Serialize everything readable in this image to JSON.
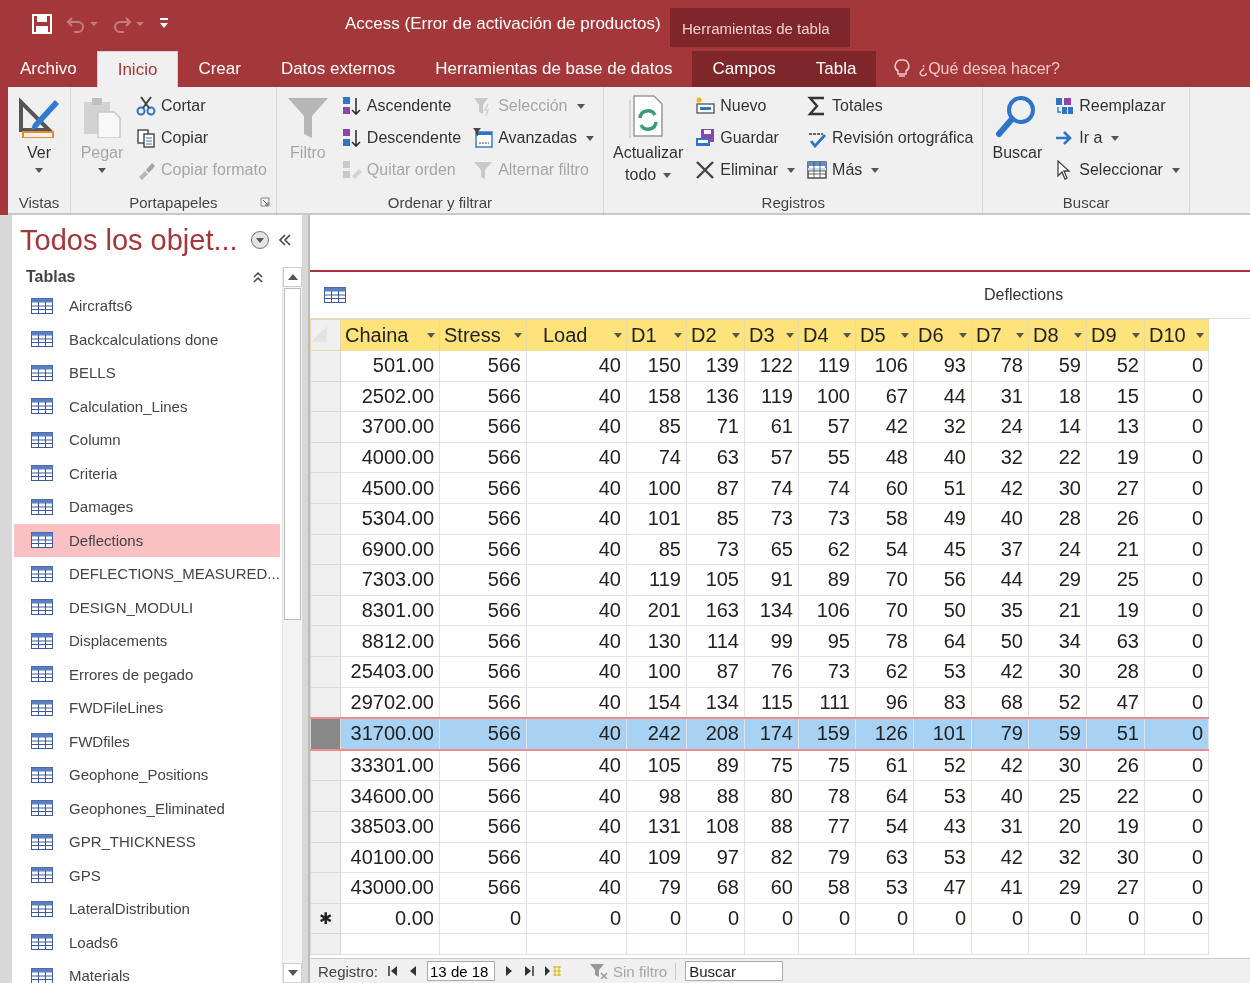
{
  "window": {
    "title": "Access (Error de activación de productos)",
    "contextual_header": "Herramientas de tabla"
  },
  "quick_access": [
    {
      "disabled": false
    },
    {
      "disabled": true
    },
    {
      "disabled": true
    }
  ],
  "tabs": [
    {
      "label": "Archivo",
      "selected": false,
      "contextual": false
    },
    {
      "label": "Inicio",
      "selected": true,
      "contextual": false
    },
    {
      "label": "Crear",
      "selected": false,
      "contextual": false
    },
    {
      "label": "Datos externos",
      "selected": false,
      "contextual": false
    },
    {
      "label": "Herramientas de base de datos",
      "selected": false,
      "contextual": false
    },
    {
      "label": "Campos",
      "selected": false,
      "contextual": true
    },
    {
      "label": "Tabla",
      "selected": false,
      "contextual": true
    }
  ],
  "tell_me": {
    "placeholder": "¿Qué desea hacer?"
  },
  "ribbon": {
    "groups": [
      {
        "label": "Vistas",
        "launcher": false,
        "items": [
          {
            "kind": "large",
            "lines": [
              "Ver"
            ],
            "disabled": false,
            "dropdown": true
          }
        ]
      },
      {
        "label": "Portapapeles",
        "launcher": true,
        "items": [
          {
            "kind": "large",
            "lines": [
              "Pegar"
            ],
            "disabled": true,
            "dropdown": true
          },
          {
            "kind": "stack",
            "buttons": [
              {
                "label": "Cortar",
                "disabled": false,
                "dropdown": false
              },
              {
                "label": "Copiar",
                "disabled": false,
                "dropdown": false
              },
              {
                "label": "Copiar formato",
                "disabled": true,
                "dropdown": false
              }
            ]
          }
        ]
      },
      {
        "label": "Ordenar y filtrar",
        "launcher": false,
        "items": [
          {
            "kind": "large",
            "lines": [
              "Filtro"
            ],
            "disabled": true,
            "dropdown": false
          },
          {
            "kind": "stack",
            "buttons": [
              {
                "label": "Ascendente",
                "disabled": false,
                "dropdown": false
              },
              {
                "label": "Descendente",
                "disabled": false,
                "dropdown": false
              },
              {
                "label": "Quitar orden",
                "disabled": true,
                "dropdown": false
              }
            ]
          },
          {
            "kind": "stack",
            "buttons": [
              {
                "label": "Selección",
                "disabled": true,
                "dropdown": true
              },
              {
                "label": "Avanzadas",
                "disabled": false,
                "dropdown": true
              },
              {
                "label": "Alternar filtro",
                "disabled": true,
                "dropdown": false
              }
            ]
          }
        ]
      },
      {
        "label": "Registros",
        "launcher": false,
        "items": [
          {
            "kind": "large",
            "lines": [
              "Actualizar",
              "todo"
            ],
            "disabled": false,
            "dropdown": true
          },
          {
            "kind": "stack",
            "buttons": [
              {
                "label": "Nuevo",
                "disabled": false,
                "dropdown": false
              },
              {
                "label": "Guardar",
                "disabled": false,
                "dropdown": false
              },
              {
                "label": "Eliminar",
                "disabled": false,
                "dropdown": true
              }
            ]
          },
          {
            "kind": "stack",
            "buttons": [
              {
                "label": "Totales",
                "disabled": false,
                "dropdown": false
              },
              {
                "label": "Revisión ortográfica",
                "disabled": false,
                "dropdown": false
              },
              {
                "label": "Más",
                "disabled": false,
                "dropdown": true
              }
            ]
          }
        ]
      },
      {
        "label": "Buscar",
        "launcher": false,
        "items": [
          {
            "kind": "large",
            "lines": [
              "Buscar"
            ],
            "disabled": false,
            "dropdown": false
          },
          {
            "kind": "stack",
            "buttons": [
              {
                "label": "Reemplazar",
                "disabled": false,
                "dropdown": false
              },
              {
                "label": "Ir a",
                "disabled": false,
                "dropdown": true
              },
              {
                "label": "Seleccionar",
                "disabled": false,
                "dropdown": true
              }
            ]
          }
        ]
      }
    ]
  },
  "navigation": {
    "title": "Todos los objet...",
    "section": "Tablas",
    "items": [
      {
        "label": "Aircrafts6",
        "selected": false
      },
      {
        "label": "Backcalculations done",
        "selected": false
      },
      {
        "label": "BELLS",
        "selected": false
      },
      {
        "label": "Calculation_Lines",
        "selected": false
      },
      {
        "label": "Column",
        "selected": false
      },
      {
        "label": "Criteria",
        "selected": false
      },
      {
        "label": "Damages",
        "selected": false
      },
      {
        "label": "Deflections",
        "selected": true
      },
      {
        "label": "DEFLECTIONS_MEASURED...",
        "selected": false
      },
      {
        "label": "DESIGN_MODULI",
        "selected": false
      },
      {
        "label": "Displacements",
        "selected": false
      },
      {
        "label": "Errores de pegado",
        "selected": false
      },
      {
        "label": "FWDFileLines",
        "selected": false
      },
      {
        "label": "FWDfiles",
        "selected": false
      },
      {
        "label": "Geophone_Positions",
        "selected": false
      },
      {
        "label": "Geophones_Eliminated",
        "selected": false
      },
      {
        "label": "GPR_THICKNESS",
        "selected": false
      },
      {
        "label": "GPS",
        "selected": false
      },
      {
        "label": "LateralDistribution",
        "selected": false
      },
      {
        "label": "Loads6",
        "selected": false
      },
      {
        "label": "Materials",
        "selected": false
      }
    ]
  },
  "table": {
    "title": "Deflections",
    "columns": [
      "Chaina",
      "Stress",
      "Load",
      "D1",
      "D2",
      "D3",
      "D4",
      "D5",
      "D6",
      "D7",
      "D8",
      "D9",
      "D10"
    ],
    "rows": [
      {
        "selected": false,
        "cells": [
          "501.00",
          "566",
          "40",
          "150",
          "139",
          "122",
          "119",
          "106",
          "93",
          "78",
          "59",
          "52",
          "0"
        ]
      },
      {
        "selected": false,
        "cells": [
          "2502.00",
          "566",
          "40",
          "158",
          "136",
          "119",
          "100",
          "67",
          "44",
          "31",
          "18",
          "15",
          "0"
        ]
      },
      {
        "selected": false,
        "cells": [
          "3700.00",
          "566",
          "40",
          "85",
          "71",
          "61",
          "57",
          "42",
          "32",
          "24",
          "14",
          "13",
          "0"
        ]
      },
      {
        "selected": false,
        "cells": [
          "4000.00",
          "566",
          "40",
          "74",
          "63",
          "57",
          "55",
          "48",
          "40",
          "32",
          "22",
          "19",
          "0"
        ]
      },
      {
        "selected": false,
        "cells": [
          "4500.00",
          "566",
          "40",
          "100",
          "87",
          "74",
          "74",
          "60",
          "51",
          "42",
          "30",
          "27",
          "0"
        ]
      },
      {
        "selected": false,
        "cells": [
          "5304.00",
          "566",
          "40",
          "101",
          "85",
          "73",
          "73",
          "58",
          "49",
          "40",
          "28",
          "26",
          "0"
        ]
      },
      {
        "selected": false,
        "cells": [
          "6900.00",
          "566",
          "40",
          "85",
          "73",
          "65",
          "62",
          "54",
          "45",
          "37",
          "24",
          "21",
          "0"
        ]
      },
      {
        "selected": false,
        "cells": [
          "7303.00",
          "566",
          "40",
          "119",
          "105",
          "91",
          "89",
          "70",
          "56",
          "44",
          "29",
          "25",
          "0"
        ]
      },
      {
        "selected": false,
        "cells": [
          "8301.00",
          "566",
          "40",
          "201",
          "163",
          "134",
          "106",
          "70",
          "50",
          "35",
          "21",
          "19",
          "0"
        ]
      },
      {
        "selected": false,
        "cells": [
          "8812.00",
          "566",
          "40",
          "130",
          "114",
          "99",
          "95",
          "78",
          "64",
          "50",
          "34",
          "63",
          "0"
        ]
      },
      {
        "selected": false,
        "cells": [
          "25403.00",
          "566",
          "40",
          "100",
          "87",
          "76",
          "73",
          "62",
          "53",
          "42",
          "30",
          "28",
          "0"
        ]
      },
      {
        "selected": false,
        "cells": [
          "29702.00",
          "566",
          "40",
          "154",
          "134",
          "115",
          "111",
          "96",
          "83",
          "68",
          "52",
          "47",
          "0"
        ]
      },
      {
        "selected": true,
        "cells": [
          "31700.00",
          "566",
          "40",
          "242",
          "208",
          "174",
          "159",
          "126",
          "101",
          "79",
          "59",
          "51",
          "0"
        ]
      },
      {
        "selected": false,
        "cells": [
          "33301.00",
          "566",
          "40",
          "105",
          "89",
          "75",
          "75",
          "61",
          "52",
          "42",
          "30",
          "26",
          "0"
        ]
      },
      {
        "selected": false,
        "cells": [
          "34600.00",
          "566",
          "40",
          "98",
          "88",
          "80",
          "78",
          "64",
          "53",
          "40",
          "25",
          "22",
          "0"
        ]
      },
      {
        "selected": false,
        "cells": [
          "38503.00",
          "566",
          "40",
          "131",
          "108",
          "88",
          "77",
          "54",
          "43",
          "31",
          "20",
          "19",
          "0"
        ]
      },
      {
        "selected": false,
        "cells": [
          "40100.00",
          "566",
          "40",
          "109",
          "97",
          "82",
          "79",
          "63",
          "53",
          "42",
          "32",
          "30",
          "0"
        ]
      },
      {
        "selected": false,
        "cells": [
          "43000.00",
          "566",
          "40",
          "79",
          "68",
          "60",
          "58",
          "53",
          "47",
          "41",
          "29",
          "27",
          "0"
        ]
      }
    ],
    "new_row": {
      "marker": "✱",
      "cells": [
        "0.00",
        "0",
        "0",
        "0",
        "0",
        "0",
        "0",
        "0",
        "0",
        "0",
        "0",
        "0",
        "0"
      ]
    }
  },
  "status_bar": {
    "label": "Registro:",
    "position": "13 de 18",
    "filter": "Sin filtro",
    "filter_disabled": true,
    "search": {
      "placeholder": "Buscar"
    }
  }
}
